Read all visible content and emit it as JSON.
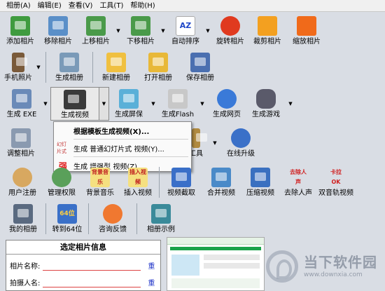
{
  "menu": [
    "相册(A)",
    "编辑(E)",
    "查看(V)",
    "工具(T)",
    "帮助(H)"
  ],
  "row1": [
    "添加相片",
    "移除相片",
    "上移相片",
    "下移相片",
    "自动排序",
    "旋转相片",
    "裁剪相片",
    "缩放相片"
  ],
  "row2": [
    "手机照片",
    "生成相册",
    "新建相册",
    "打开相册",
    "保存相册"
  ],
  "row3": [
    "生成 EXE",
    "生成视频",
    "生成屏保",
    "生成Flash",
    "生成网页",
    "生成游戏"
  ],
  "row4": [
    "调整相片",
    "工具",
    "在线升级"
  ],
  "row5": [
    "用户注册",
    "管理权限",
    "背景音乐",
    "插入视频",
    "视频截取",
    "合并视频",
    "压缩视频",
    "去除人声",
    "双音轨视频"
  ],
  "row6": [
    "我的相册",
    "转到64位",
    "咨询反馈",
    "相册示例"
  ],
  "dropdown": {
    "items": [
      "根据模板生成视频(X)...",
      "生成 普通幻灯片式 视频(Y)...",
      "生成 增强型 视频(Z)..."
    ],
    "icon2": "幻灯片式",
    "icon3": "强"
  },
  "icon_text": {
    "music": "背景音乐",
    "video": "插入视频",
    "voice": "去除人声",
    "dual": "卡拉OK",
    "x64": "64位"
  },
  "info": {
    "title": "选定相片信息",
    "name_label": "相片名称:",
    "shooter_label": "拍摄人名:",
    "modify": "重"
  },
  "watermark": {
    "title": "当下软件园",
    "url": "www.downxia.com"
  },
  "colors": {
    "accent": "#1f33c8",
    "line": "#dd4444"
  }
}
